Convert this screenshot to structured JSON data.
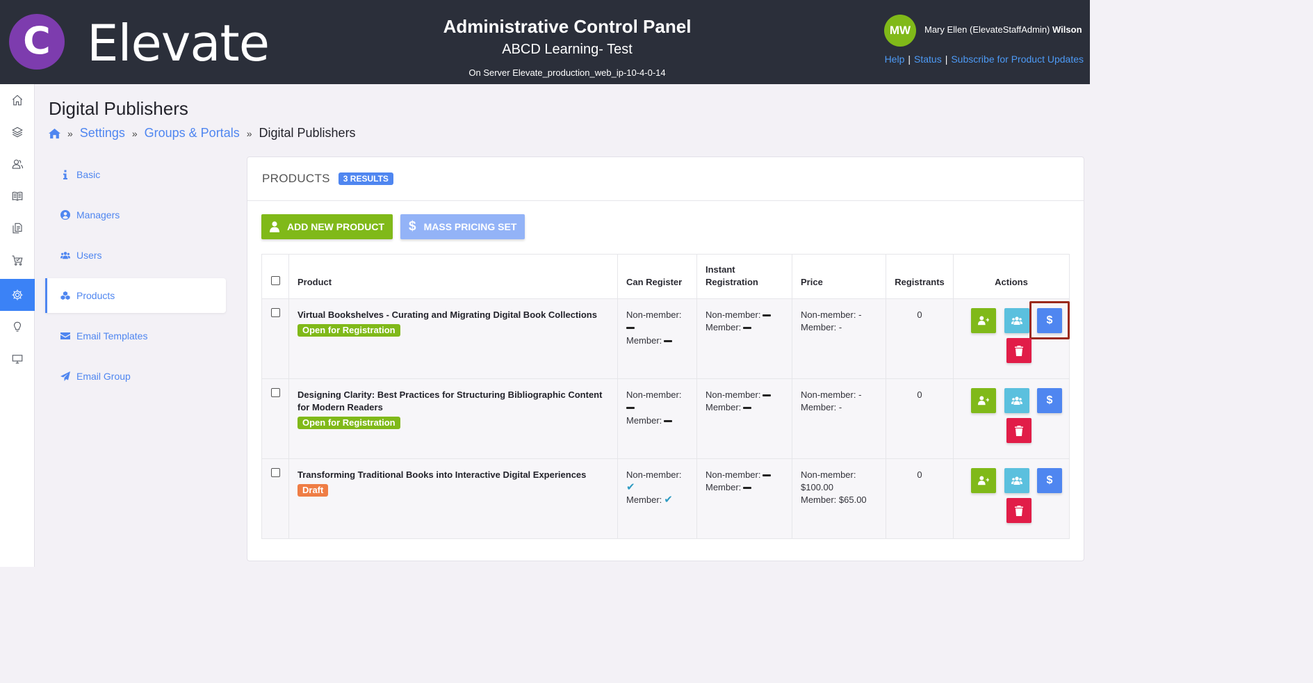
{
  "header": {
    "logo_letter": "C",
    "app_name": "Elevate",
    "title": "Administrative Control Panel",
    "subtitle": "ABCD Learning- Test",
    "server": "On Server Elevate_production_web_ip-10-4-0-14",
    "user_initials": "MW",
    "user_name_prefix": "Mary Ellen (ElevateStaffAdmin)",
    "user_name_last": "Wilson",
    "links": [
      "Help",
      "Status",
      "Subscribe for Product Updates"
    ]
  },
  "rail": {
    "icons": [
      "home-icon",
      "layers-icon",
      "users-icon",
      "book-icon",
      "documents-icon",
      "cart-icon",
      "gear-icon",
      "lightbulb-icon",
      "monitor-icon"
    ],
    "active": "gear-icon"
  },
  "page": {
    "title": "Digital Publishers",
    "breadcrumb": [
      "Settings",
      "Groups & Portals",
      "Digital Publishers"
    ]
  },
  "side_menu": {
    "items": [
      {
        "label": "Basic",
        "icon": "info-icon"
      },
      {
        "label": "Managers",
        "icon": "user-circle-icon"
      },
      {
        "label": "Users",
        "icon": "users-icon"
      },
      {
        "label": "Products",
        "icon": "cubes-icon"
      },
      {
        "label": "Email Templates",
        "icon": "envelope-icon"
      },
      {
        "label": "Email Group",
        "icon": "paper-plane-icon"
      }
    ],
    "active": "Products"
  },
  "panel": {
    "title": "PRODUCTS",
    "results_badge": "3 RESULTS",
    "add_button": "ADD NEW PRODUCT",
    "mass_button": "MASS PRICING SET"
  },
  "table": {
    "headers": [
      "Product",
      "Can Register",
      "Instant Registration",
      "Price",
      "Registrants",
      "Actions"
    ],
    "rows": [
      {
        "product": "Virtual Bookshelves - Curating and Migrating Digital Book Collections",
        "status": "Open for Registration",
        "can_register_nonmember_label": "Non-member:",
        "can_register_member_label": "Member:",
        "can_register_nonmember": "dash",
        "can_register_member": "dash",
        "instant_nonmember_label": "Non-member:",
        "instant_member_label": "Member:",
        "price_nonmember": "Non-member: -",
        "price_member": "Member: -",
        "registrants": "0"
      },
      {
        "product": "Designing Clarity: Best Practices for Structuring Bibliographic Content for Modern Readers",
        "status": "Open for Registration",
        "can_register_nonmember_label": "Non-member:",
        "can_register_member_label": "Member:",
        "can_register_nonmember": "dash",
        "can_register_member": "dash",
        "instant_nonmember_label": "Non-member:",
        "instant_member_label": "Member:",
        "price_nonmember": "Non-member: -",
        "price_member": "Member: -",
        "registrants": "0"
      },
      {
        "product": "Transforming Traditional Books into Interactive Digital Experiences",
        "status": "Draft",
        "can_register_nonmember_label": "Non-member:",
        "can_register_member_label": "Member:",
        "can_register_nonmember": "check",
        "can_register_member": "check",
        "instant_nonmember_label": "Non-member:",
        "instant_member_label": "Member:",
        "price_nonmember_label": "Non-member:",
        "price_nonmember_value": "$100.00",
        "price_member": "Member: $65.00",
        "registrants": "0"
      }
    ]
  },
  "colors": {
    "header_bg": "#2b2f3a",
    "logo_purple": "#7d3cae",
    "green": "#80b919",
    "blue": "#4f86f0",
    "cyan": "#5bc0de",
    "red": "#e11d48",
    "draft_orange": "#ef7d45",
    "highlight": "#9b2a1c"
  }
}
